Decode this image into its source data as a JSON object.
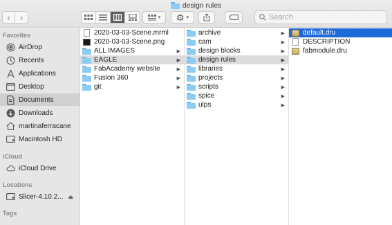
{
  "window": {
    "title": "design rules",
    "title_icon": "folder-icon"
  },
  "toolbar": {
    "back_icon": "chevron-left-icon",
    "forward_icon": "chevron-right-icon",
    "view_modes": [
      "icon-view-icon",
      "list-view-icon",
      "column-view-icon",
      "gallery-view-icon"
    ],
    "active_view": "column-view-icon",
    "group_icon": "group-by-icon",
    "action_icon": "gear-icon",
    "share_icon": "share-icon",
    "tag_icon": "tag-icon",
    "search_placeholder": "Search"
  },
  "sidebar": {
    "favorites_heading": "Favorites",
    "favorites": [
      {
        "label": "AirDrop",
        "icon": "airdrop-icon"
      },
      {
        "label": "Recents",
        "icon": "clock-icon"
      },
      {
        "label": "Applications",
        "icon": "applications-icon"
      },
      {
        "label": "Desktop",
        "icon": "desktop-icon"
      },
      {
        "label": "Documents",
        "icon": "document-icon",
        "selected": true
      },
      {
        "label": "Downloads",
        "icon": "download-icon"
      },
      {
        "label": "martinaferracane",
        "icon": "home-icon"
      },
      {
        "label": "Macintosh HD",
        "icon": "hard-drive-icon"
      }
    ],
    "icloud_heading": "iCloud",
    "icloud": [
      {
        "label": "iCloud Drive",
        "icon": "cloud-icon"
      }
    ],
    "locations_heading": "Locations",
    "locations": [
      {
        "label": "Slicer-4.10.2...",
        "icon": "disk-image-icon",
        "eject_icon": "eject-icon"
      }
    ],
    "tags_heading": "Tags"
  },
  "columns": {
    "col1": [
      {
        "name": "2020-03-03-Scene.mrml",
        "kind": "document"
      },
      {
        "name": "2020-03-03-Scene.png",
        "kind": "image"
      },
      {
        "name": "ALL IMAGES",
        "kind": "folder"
      },
      {
        "name": "EAGLE",
        "kind": "folder",
        "selected": true
      },
      {
        "name": "FabAcademy website",
        "kind": "folder"
      },
      {
        "name": "Fusion 360",
        "kind": "folder"
      },
      {
        "name": "git",
        "kind": "folder"
      }
    ],
    "col2": [
      {
        "name": "archive",
        "kind": "folder"
      },
      {
        "name": "cam",
        "kind": "folder"
      },
      {
        "name": "design blocks",
        "kind": "folder"
      },
      {
        "name": "design rules",
        "kind": "folder",
        "selected": true
      },
      {
        "name": "libraries",
        "kind": "folder"
      },
      {
        "name": "projects",
        "kind": "folder"
      },
      {
        "name": "scripts",
        "kind": "folder"
      },
      {
        "name": "spice",
        "kind": "folder"
      },
      {
        "name": "ulps",
        "kind": "folder"
      }
    ],
    "col3": [
      {
        "name": "default.dru",
        "kind": "dru",
        "selected": true
      },
      {
        "name": "DESCRIPTION",
        "kind": "document"
      },
      {
        "name": "fabmodule.dru",
        "kind": "dru"
      }
    ]
  },
  "colors": {
    "selection_blue": "#1f6ad9",
    "folder_blue": "#8ccbf2",
    "sidebar_bg": "#e6e6e6"
  }
}
